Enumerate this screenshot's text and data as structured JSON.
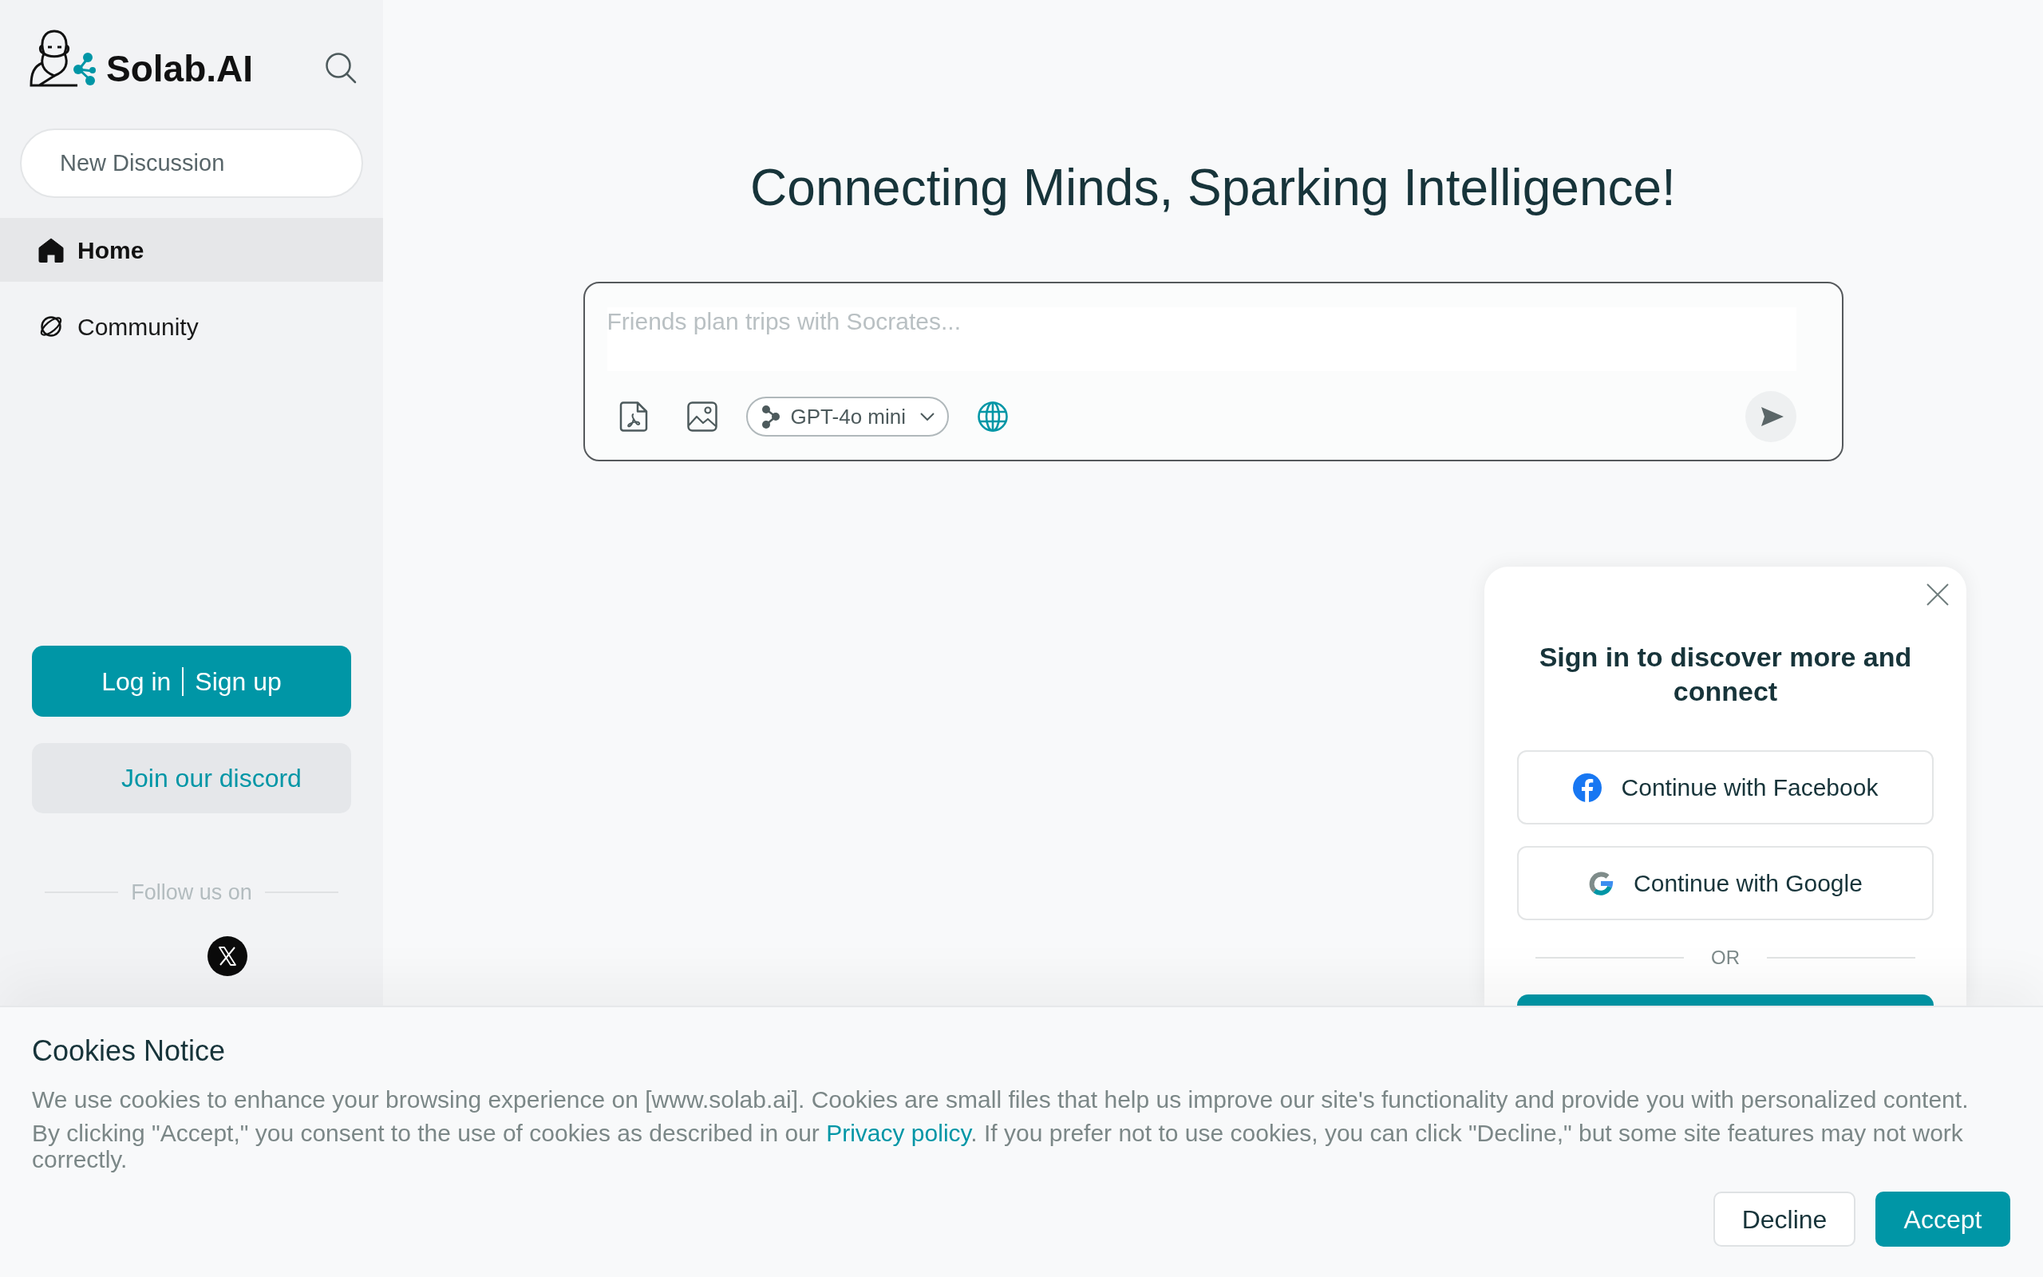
{
  "sidebar": {
    "logo_text": "Solab.AI",
    "new_discussion_button": "New Discussion",
    "nav_items": [
      {
        "kind": "home",
        "label": "Home",
        "selected": true
      },
      {
        "kind": "community",
        "label": "Community",
        "selected": false
      }
    ],
    "auth": {
      "log_in": "Log in",
      "sign_up": "Sign up"
    },
    "discord_button": "Join our discord",
    "follow_label": "Follow us on"
  },
  "main": {
    "headline": "Connecting Minds, Sparking Intelligence!",
    "composer": {
      "placeholder": "Friends plan trips with Socrates...",
      "model": "GPT-4o mini"
    }
  },
  "sign_in_dialog": {
    "title": "Sign in to discover more and connect",
    "providers": [
      {
        "kind": "facebook",
        "label": "Continue with Facebook"
      },
      {
        "kind": "google",
        "label": "Continue with Google"
      }
    ],
    "divider": "OR"
  },
  "cookie_notice": {
    "title": "Cookies Notice",
    "intro": "We use cookies to enhance your browsing experience on [www.solab.ai]. Cookies are small files that help us improve our site's functionality and provide you with personalized content.",
    "consent": {
      "before": "By clicking \"Accept,\" you consent to the use of cookies as described in our ",
      "link": "Privacy policy",
      "after": ". If you prefer not to use cookies, you can click \"Decline,\" but some site features may not work correctly."
    },
    "buttons": [
      {
        "kind": "decline",
        "label": "Decline"
      },
      {
        "kind": "accept",
        "label": "Accept"
      }
    ]
  }
}
